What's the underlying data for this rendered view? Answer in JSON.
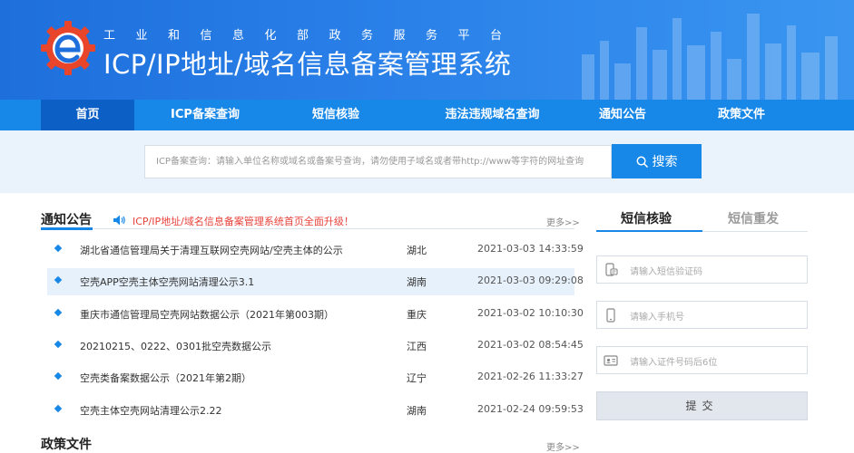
{
  "header": {
    "subtitle": "工业和信息化部政务服务平台",
    "title": "ICP/IP地址/域名信息备案管理系统",
    "logo_icon": "miit-gear-logo"
  },
  "nav": {
    "items": [
      {
        "label": "首页",
        "active": true
      },
      {
        "label": "ICP备案查询",
        "active": false
      },
      {
        "label": "短信核验",
        "active": false
      },
      {
        "label": "违法违规域名查询",
        "active": false
      },
      {
        "label": "通知公告",
        "active": false
      },
      {
        "label": "政策文件",
        "active": false
      }
    ]
  },
  "search": {
    "placeholder": "ICP备案查询：请输入单位名称或域名或备案号查询，请勿使用子域名或者带http://www等字符的网址查询",
    "button_label": "搜索",
    "button_icon": "search-icon"
  },
  "notices": {
    "title": "通知公告",
    "marquee": "ICP/IP地址/域名信息备案管理系统首页全面升级！",
    "more": "更多>>",
    "rows": [
      {
        "title": "湖北省通信管理局关于清理互联网空壳网站/空壳主体的公示",
        "province": "湖北",
        "date": "2021-03-03 14:33:59"
      },
      {
        "title": "空壳APP空壳主体空壳网站清理公示3.1",
        "province": "湖南",
        "date": "2021-03-03 09:29:08"
      },
      {
        "title": "重庆市通信管理局空壳网站数据公示（2021年第003期）",
        "province": "重庆",
        "date": "2021-03-02 10:10:30"
      },
      {
        "title": "20210215、0222、0301批空壳数据公示",
        "province": "江西",
        "date": "2021-03-02 08:54:45"
      },
      {
        "title": "空壳类备案数据公示（2021年第2期）",
        "province": "辽宁",
        "date": "2021-02-26 11:33:27"
      },
      {
        "title": "空壳主体空壳网站清理公示2.22",
        "province": "湖南",
        "date": "2021-02-24 09:59:53"
      }
    ]
  },
  "policy": {
    "title": "政策文件",
    "more": "更多>>"
  },
  "sms": {
    "tabs": [
      {
        "label": "短信核验",
        "active": true
      },
      {
        "label": "短信重发",
        "active": false
      }
    ],
    "fields": [
      {
        "placeholder": "请输入短信验证码",
        "icon": "sms-code-icon"
      },
      {
        "placeholder": "请输入手机号",
        "icon": "phone-icon"
      },
      {
        "placeholder": "请输入证件号码后6位",
        "icon": "id-card-icon"
      }
    ],
    "submit_label": "提交"
  },
  "colors": {
    "brand_blue": "#1787e8",
    "nav_active": "#0c5fc4",
    "marquee_red": "#e8413a"
  }
}
